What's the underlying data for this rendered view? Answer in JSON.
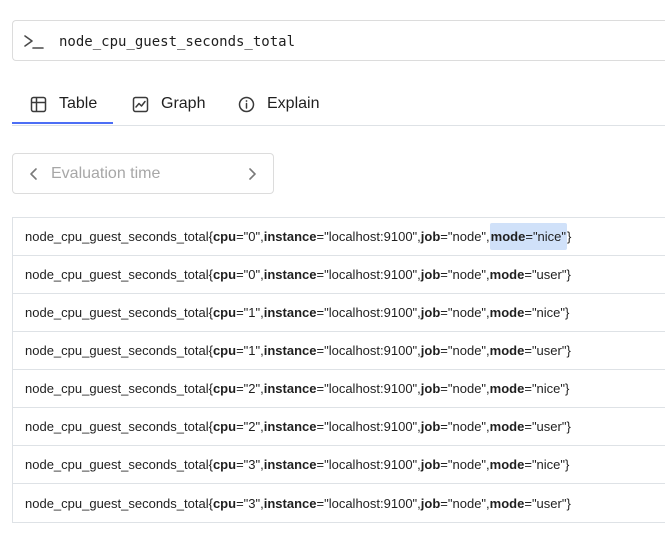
{
  "expression": {
    "prompt_icon": "terminal-prompt-icon",
    "text": "node_cpu_guest_seconds_total"
  },
  "tabs": [
    {
      "icon": "table-icon",
      "label": "Table",
      "active": true
    },
    {
      "icon": "graph-icon",
      "label": "Graph",
      "active": false
    },
    {
      "icon": "info-icon",
      "label": "Explain",
      "active": false
    }
  ],
  "eval_time": {
    "placeholder": "Evaluation time",
    "value": "",
    "prev_icon": "chevron-left-icon",
    "next_icon": "chevron-right-icon"
  },
  "colors": {
    "accent": "#4c6ef5",
    "highlight": "#d0e1f9",
    "border": "#dee2e6"
  },
  "series": [
    {
      "metric": "node_cpu_guest_seconds_total",
      "cpu": "\"0\"",
      "instance": "\"localhost:9100\"",
      "job": "\"node\"",
      "mode": "\"nice\"",
      "highlight_mode": true
    },
    {
      "metric": "node_cpu_guest_seconds_total",
      "cpu": "\"0\"",
      "instance": "\"localhost:9100\"",
      "job": "\"node\"",
      "mode": "\"user\"",
      "highlight_mode": false
    },
    {
      "metric": "node_cpu_guest_seconds_total",
      "cpu": "\"1\"",
      "instance": "\"localhost:9100\"",
      "job": "\"node\"",
      "mode": "\"nice\"",
      "highlight_mode": false
    },
    {
      "metric": "node_cpu_guest_seconds_total",
      "cpu": "\"1\"",
      "instance": "\"localhost:9100\"",
      "job": "\"node\"",
      "mode": "\"user\"",
      "highlight_mode": false
    },
    {
      "metric": "node_cpu_guest_seconds_total",
      "cpu": "\"2\"",
      "instance": "\"localhost:9100\"",
      "job": "\"node\"",
      "mode": "\"nice\"",
      "highlight_mode": false
    },
    {
      "metric": "node_cpu_guest_seconds_total",
      "cpu": "\"2\"",
      "instance": "\"localhost:9100\"",
      "job": "\"node\"",
      "mode": "\"user\"",
      "highlight_mode": false
    },
    {
      "metric": "node_cpu_guest_seconds_total",
      "cpu": "\"3\"",
      "instance": "\"localhost:9100\"",
      "job": "\"node\"",
      "mode": "\"nice\"",
      "highlight_mode": false
    },
    {
      "metric": "node_cpu_guest_seconds_total",
      "cpu": "\"3\"",
      "instance": "\"localhost:9100\"",
      "job": "\"node\"",
      "mode": "\"user\"",
      "highlight_mode": false
    }
  ],
  "label_names": {
    "cpu": "cpu",
    "instance": "instance",
    "job": "job",
    "mode": "mode"
  }
}
